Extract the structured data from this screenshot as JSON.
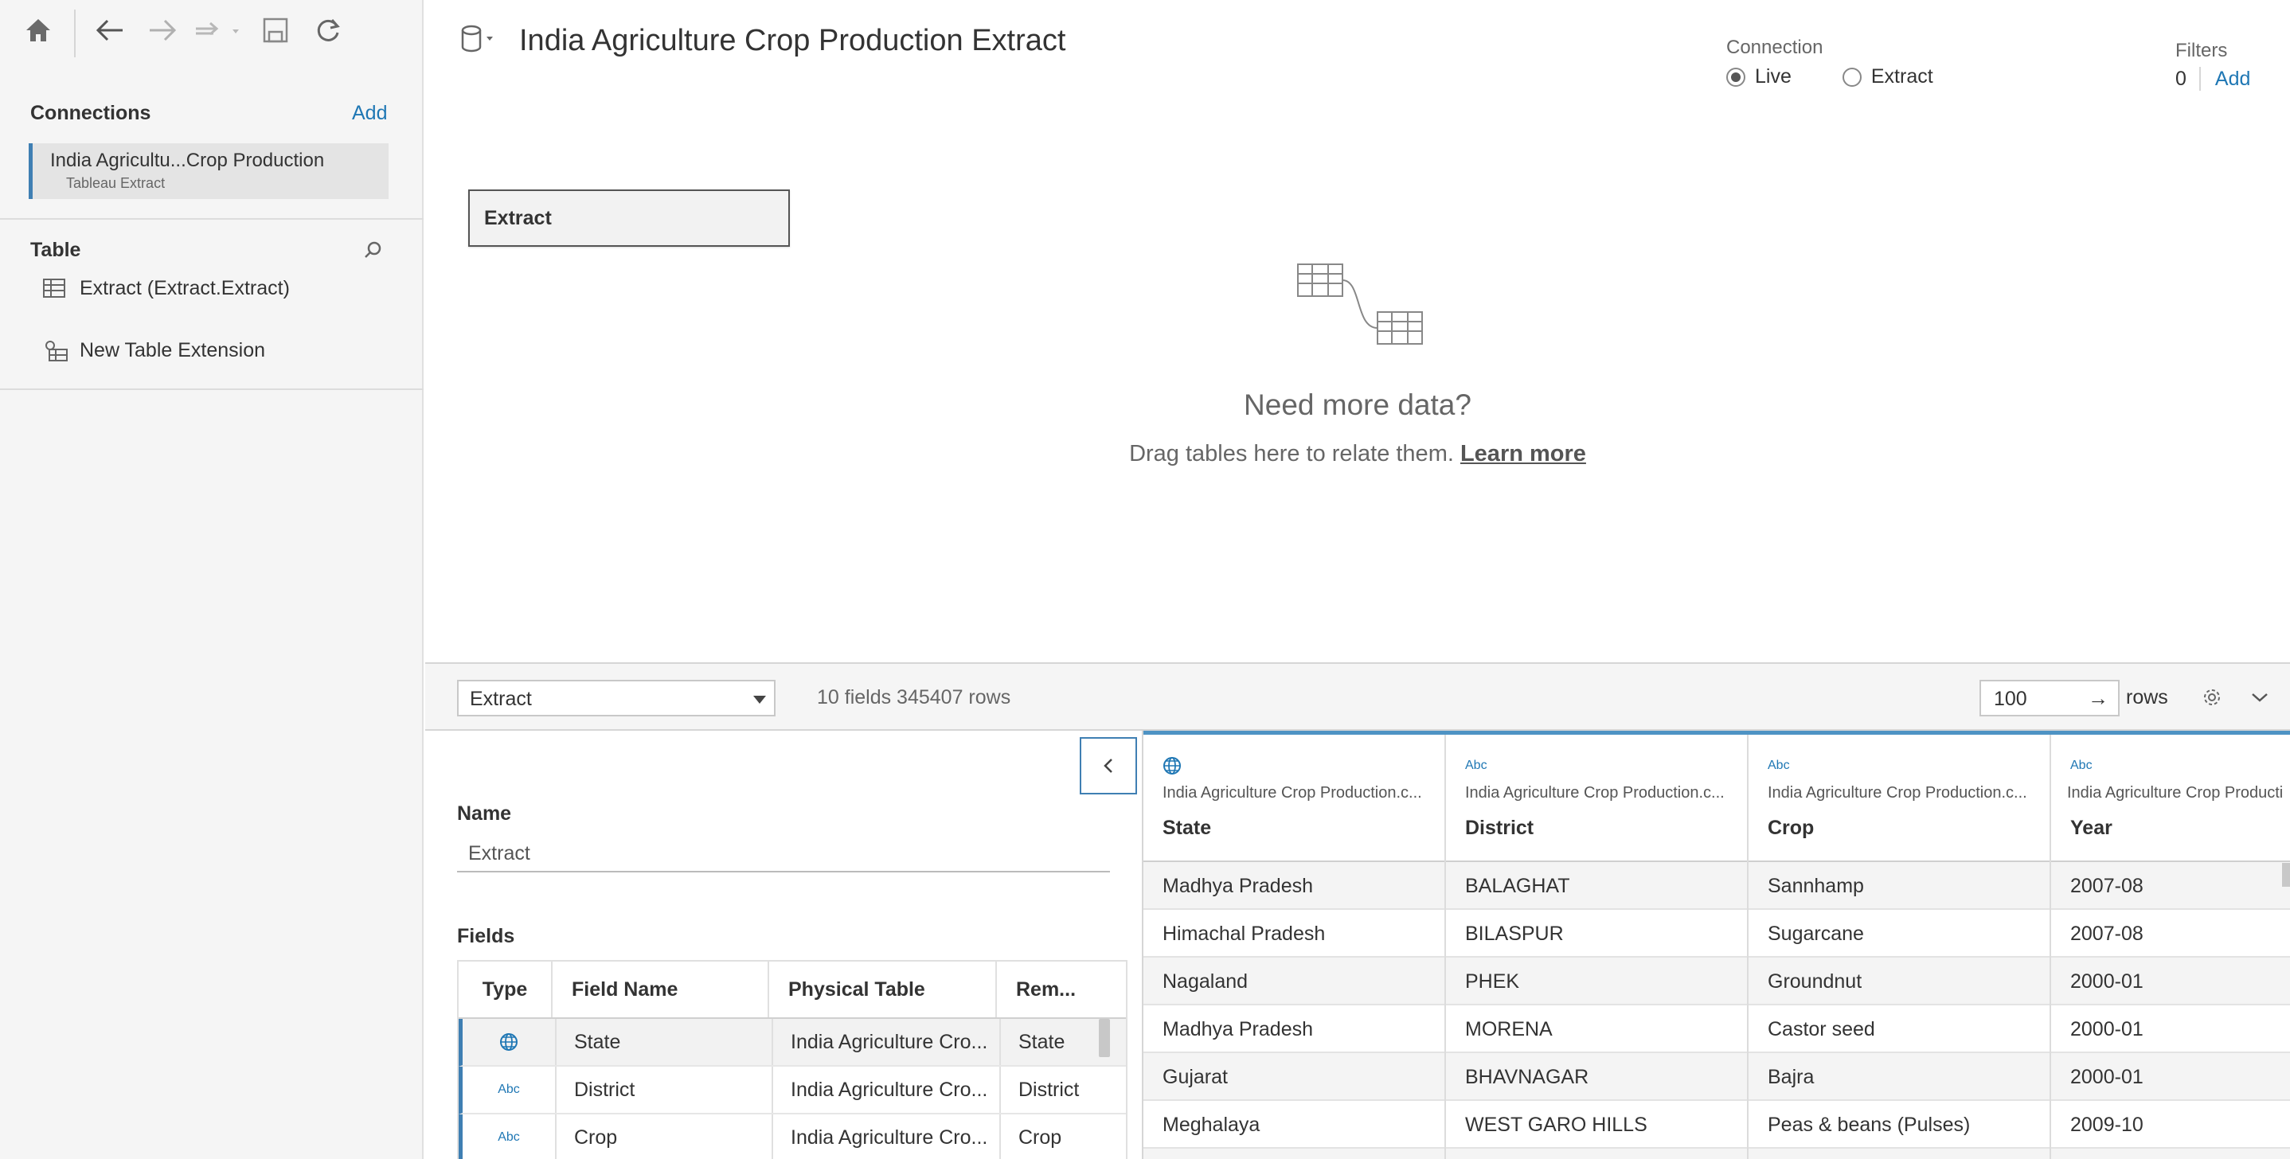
{
  "toolbar": {
    "icons": [
      "home-icon",
      "back-icon",
      "forward-icon",
      "paste-dropdown-icon",
      "save-icon",
      "refresh-icon"
    ]
  },
  "sidebar": {
    "connections_label": "Connections",
    "add_label": "Add",
    "connection": {
      "name": "India Agricultu...Crop Production",
      "type": "Tableau Extract"
    },
    "table_label": "Table",
    "tables": [
      {
        "label": "Extract (Extract.Extract)",
        "icon": "table-icon"
      },
      {
        "label": "New Table Extension",
        "icon": "table-extension-icon"
      }
    ]
  },
  "header": {
    "title": "India Agriculture Crop Production Extract",
    "connection_label": "Connection",
    "live_label": "Live",
    "extract_label": "Extract",
    "connection_mode": "Live",
    "filters_label": "Filters",
    "filters_count": "0",
    "filters_add": "Add"
  },
  "canvas": {
    "table_box": "Extract",
    "need_title": "Need more data?",
    "need_sub": "Drag tables here to relate them.",
    "learn_more": "Learn more"
  },
  "bar": {
    "select_value": "Extract",
    "counts": "10 fields 345407 rows",
    "rows_value": "100",
    "rows_label": "rows"
  },
  "meta": {
    "name_label": "Name",
    "name_value": "Extract",
    "fields_label": "Fields",
    "columns": [
      "Type",
      "Field Name",
      "Physical Table",
      "Rem..."
    ],
    "rows": [
      {
        "type": "globe",
        "type_label": "",
        "name": "State",
        "table": "India Agriculture Cro...",
        "remote": "State"
      },
      {
        "type": "abc",
        "type_label": "Abc",
        "name": "District",
        "table": "India Agriculture Cro...",
        "remote": "District"
      },
      {
        "type": "abc",
        "type_label": "Abc",
        "name": "Crop",
        "table": "India Agriculture Cro...",
        "remote": "Crop"
      }
    ]
  },
  "grid": {
    "columns": [
      {
        "type": "globe",
        "type_label": "",
        "source": "India Agriculture Crop Production.c...",
        "name": "State"
      },
      {
        "type": "abc",
        "type_label": "Abc",
        "source": "India Agriculture Crop Production.c...",
        "name": "District"
      },
      {
        "type": "abc",
        "type_label": "Abc",
        "source": "India Agriculture Crop Production.c...",
        "name": "Crop"
      },
      {
        "type": "abc",
        "type_label": "Abc",
        "source": "India Agriculture Crop Producti",
        "name": "Year"
      }
    ],
    "rows": [
      [
        "Madhya Pradesh",
        "BALAGHAT",
        "Sannhamp",
        "2007-08"
      ],
      [
        "Himachal Pradesh",
        "BILASPUR",
        "Sugarcane",
        "2007-08"
      ],
      [
        "Nagaland",
        "PHEK",
        "Groundnut",
        "2000-01"
      ],
      [
        "Madhya Pradesh",
        "MORENA",
        "Castor seed",
        "2000-01"
      ],
      [
        "Gujarat",
        "BHAVNAGAR",
        "Bajra",
        "2000-01"
      ],
      [
        "Meghalaya",
        "WEST GARO HILLS",
        "Peas & beans (Pulses)",
        "2009-10"
      ]
    ]
  },
  "colors": {
    "accent": "#1f77b4",
    "selection_bar": "#3f7fb3",
    "grid_top": "#4e93c4"
  }
}
